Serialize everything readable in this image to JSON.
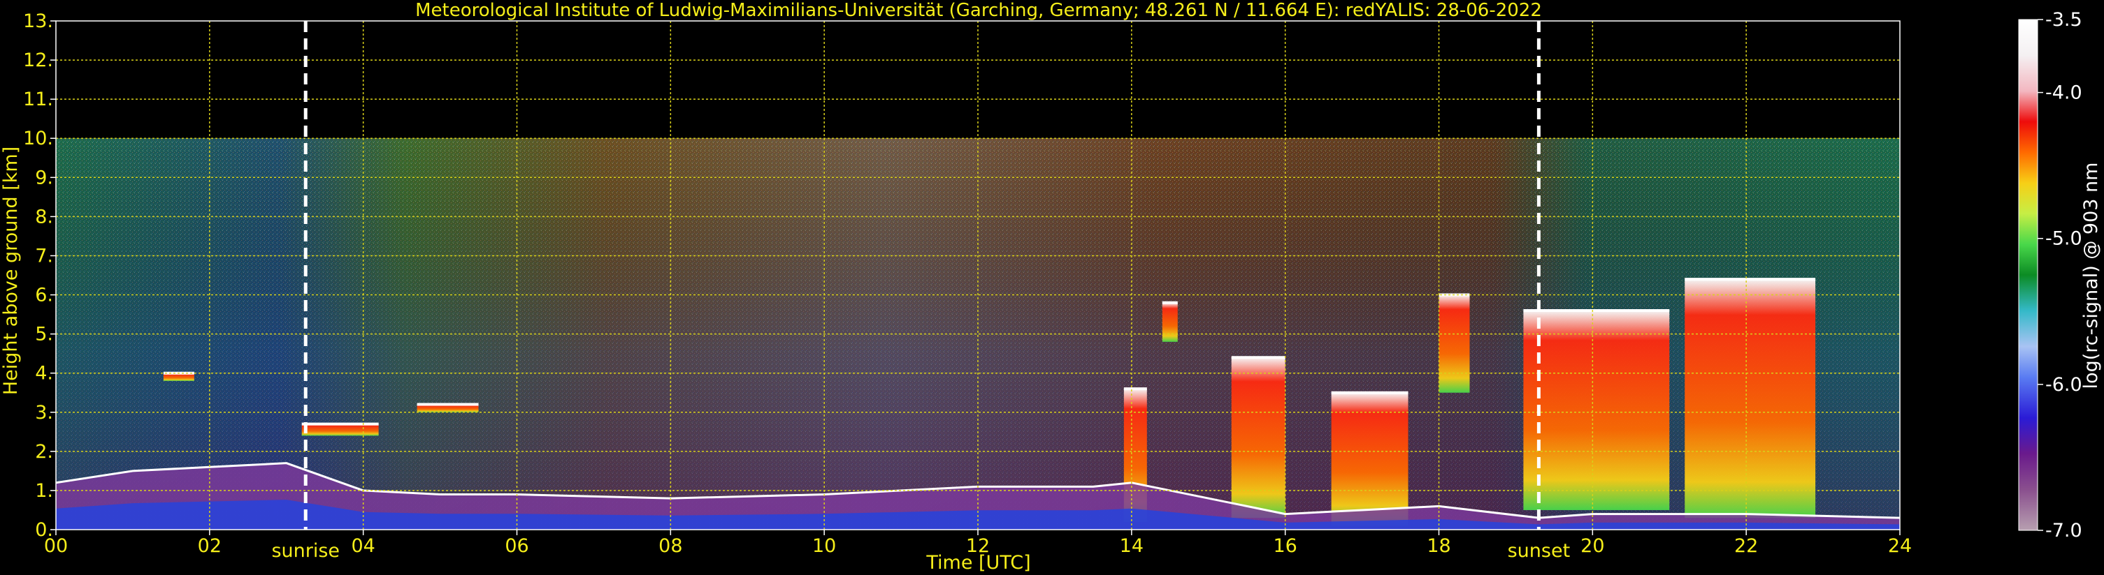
{
  "chart_data": {
    "type": "heatmap",
    "title": "Meteorological Institute of Ludwig-Maximilians-Universität (Garching, Germany; 48.261 N / 11.664 E):    redYALIS: 28-06-2022",
    "xlabel": "Time [UTC]",
    "ylabel": "Height above ground [km]",
    "xlim": [
      0,
      24
    ],
    "ylim": [
      0,
      13
    ],
    "x_ticks": [
      0,
      2,
      4,
      6,
      8,
      10,
      12,
      14,
      16,
      18,
      20,
      22,
      24
    ],
    "x_tick_labels": [
      "00",
      "02",
      "04",
      "06",
      "08",
      "10",
      "12",
      "14",
      "16",
      "18",
      "20",
      "22",
      "24"
    ],
    "y_ticks": [
      0,
      1,
      2,
      3,
      4,
      5,
      6,
      7,
      8,
      9,
      10,
      11,
      12,
      13
    ],
    "y_tick_labels": [
      "0.",
      "1.",
      "2.",
      "3.",
      "4.",
      "5.",
      "6.",
      "7.",
      "8.",
      "9.",
      "10.",
      "11.",
      "12.",
      "13."
    ],
    "grid": true,
    "data_top_km": 10,
    "colorbar": {
      "label": "log(rc-signal) @ 903 nm",
      "range": [
        -7.0,
        -3.5
      ],
      "ticks": [
        -3.5,
        -4.0,
        -5.0,
        -6.0,
        -7.0
      ],
      "tick_labels": [
        "-3.5",
        "-4.0",
        "-5.0",
        "-6.0",
        "-7.0"
      ]
    },
    "markers": [
      {
        "label": "sunrise",
        "time": 3.25
      },
      {
        "label": "sunset",
        "time": 19.3
      }
    ],
    "boundary_layer_top": [
      [
        0,
        1.2
      ],
      [
        1,
        1.5
      ],
      [
        2,
        1.6
      ],
      [
        3,
        1.7
      ],
      [
        4,
        1.0
      ],
      [
        5,
        0.9
      ],
      [
        6,
        0.9
      ],
      [
        8,
        0.8
      ],
      [
        10,
        0.9
      ],
      [
        12,
        1.1
      ],
      [
        13.5,
        1.1
      ],
      [
        14,
        1.2
      ],
      [
        16,
        0.4
      ],
      [
        17,
        0.5
      ],
      [
        18,
        0.6
      ],
      [
        19.3,
        0.3
      ],
      [
        20,
        0.4
      ],
      [
        22,
        0.4
      ],
      [
        24,
        0.3
      ]
    ],
    "cloud_layers": [
      {
        "start": 1.4,
        "end": 1.8,
        "base": 3.8,
        "top": 4.0
      },
      {
        "start": 3.2,
        "end": 4.2,
        "base": 2.4,
        "top": 2.7
      },
      {
        "start": 4.7,
        "end": 5.5,
        "base": 3.0,
        "top": 3.2
      },
      {
        "start": 13.9,
        "end": 14.2,
        "base": 0.2,
        "top": 3.6
      },
      {
        "start": 14.4,
        "end": 14.6,
        "base": 4.8,
        "top": 5.8
      },
      {
        "start": 15.3,
        "end": 16.0,
        "base": 0.3,
        "top": 4.4
      },
      {
        "start": 16.6,
        "end": 17.6,
        "base": 0.1,
        "top": 3.5
      },
      {
        "start": 18.0,
        "end": 18.4,
        "base": 3.5,
        "top": 6.0
      },
      {
        "start": 19.1,
        "end": 21.0,
        "base": 0.5,
        "top": 5.6
      },
      {
        "start": 21.2,
        "end": 22.9,
        "base": 0.3,
        "top": 6.4
      }
    ]
  },
  "colors": {
    "text": "#f5ee1a",
    "grid": "#d9d11a",
    "marker": "#ffffff",
    "background": "#000000"
  }
}
